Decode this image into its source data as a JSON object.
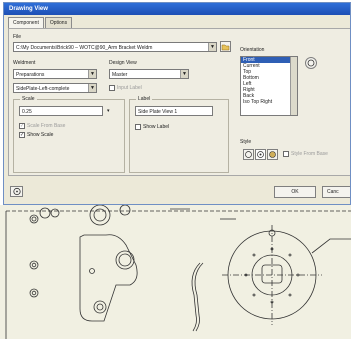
{
  "window": {
    "title": "Drawing View"
  },
  "tabs": [
    {
      "label": "Component"
    },
    {
      "label": "Options"
    }
  ],
  "file": {
    "label": "File",
    "value": "C:\\My Documents\\Brick90 – WOTC@90_Arm Bracket Weldm"
  },
  "weldment": {
    "label": "Weldment",
    "value": "Preparations",
    "view_value": "SidePlate-Left-complete"
  },
  "design_view": {
    "label": "Design View",
    "value": "Master",
    "input_label": "Input Label"
  },
  "scale": {
    "group_label": "Scale",
    "value": "0.25",
    "from_base": "Scale From Base",
    "show": "Show Scale"
  },
  "label": {
    "group_label": "Label",
    "value": "Side Plate View 1",
    "show": "Show Label"
  },
  "orientation": {
    "label": "Orientation",
    "items": [
      "Front",
      "Current",
      "Top",
      "Bottom",
      "Left",
      "Right",
      "Back",
      "Iso Top Right"
    ]
  },
  "style": {
    "label": "Style",
    "from_base": "Style From Base"
  },
  "buttons": {
    "ok": "OK",
    "cancel": "Canc"
  }
}
